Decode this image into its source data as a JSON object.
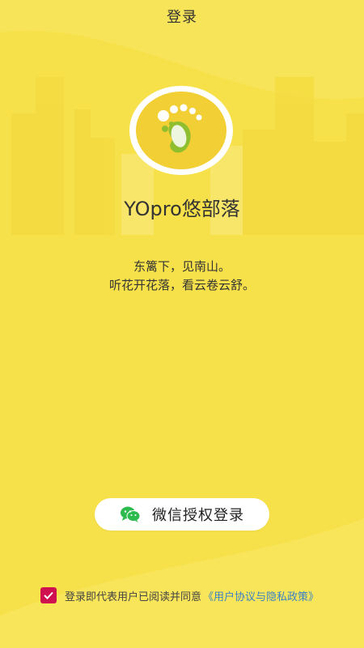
{
  "header": {
    "title": "登录"
  },
  "app": {
    "name": "YOpro悠部落"
  },
  "slogan": {
    "line1": "东篱下，见南山。",
    "line2": "听花开花落，看云卷云舒。"
  },
  "login": {
    "wechat_label": "微信授权登录"
  },
  "agreement": {
    "text": "登录即代表用户已阅读并同意",
    "policy_link": "《用户协议与隐私政策》",
    "checked": true
  },
  "icons": {
    "logo": "footprint-logo-icon",
    "wechat": "wechat-icon",
    "check": "check-icon"
  },
  "colors": {
    "background": "#f7e14a",
    "logo_yellow": "#f2cf35",
    "logo_green": "#8fbf2f",
    "checkbox": "#d0114f",
    "link": "#3b82c4"
  }
}
